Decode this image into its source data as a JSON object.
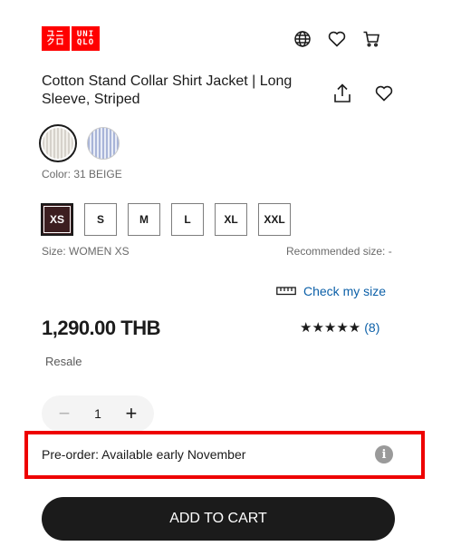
{
  "brand": {
    "logo_left_top": "ユニ",
    "logo_left_bottom": "クロ",
    "logo_right_top": "UNI",
    "logo_right_bottom": "QLO",
    "color": "#ff0000"
  },
  "header": {
    "icons": [
      "globe-icon",
      "heart-icon",
      "cart-icon"
    ]
  },
  "product": {
    "title": "Cotton Stand Collar Shirt Jacket | Long Sleeve, Striped",
    "action_icons": [
      "share-icon",
      "heart-icon"
    ],
    "colors": [
      {
        "name": "31 BEIGE",
        "selected": true
      },
      {
        "name": "blue stripe",
        "selected": false
      }
    ],
    "color_label": "Color: 31 BEIGE",
    "sizes": [
      "XS",
      "S",
      "M",
      "L",
      "XL",
      "XXL"
    ],
    "selected_size": "XS",
    "size_label": "Size: WOMEN XS",
    "recommended_size": "Recommended size: -",
    "check_size": "Check my size",
    "price": "1,290.00 THB",
    "stars": "★★★★★",
    "rating_count": "(8)",
    "resale": "Resale",
    "quantity": {
      "minus": "−",
      "value": "1",
      "plus": "+"
    },
    "preorder_text": "Pre-order: Available early November",
    "info_glyph": "i",
    "add_to_cart": "ADD TO CART"
  },
  "colors": {
    "link": "#0c60a8",
    "highlight_border": "#ee0000",
    "selected_size_bg": "#3c1e20",
    "button_bg": "#1b1b1b"
  }
}
